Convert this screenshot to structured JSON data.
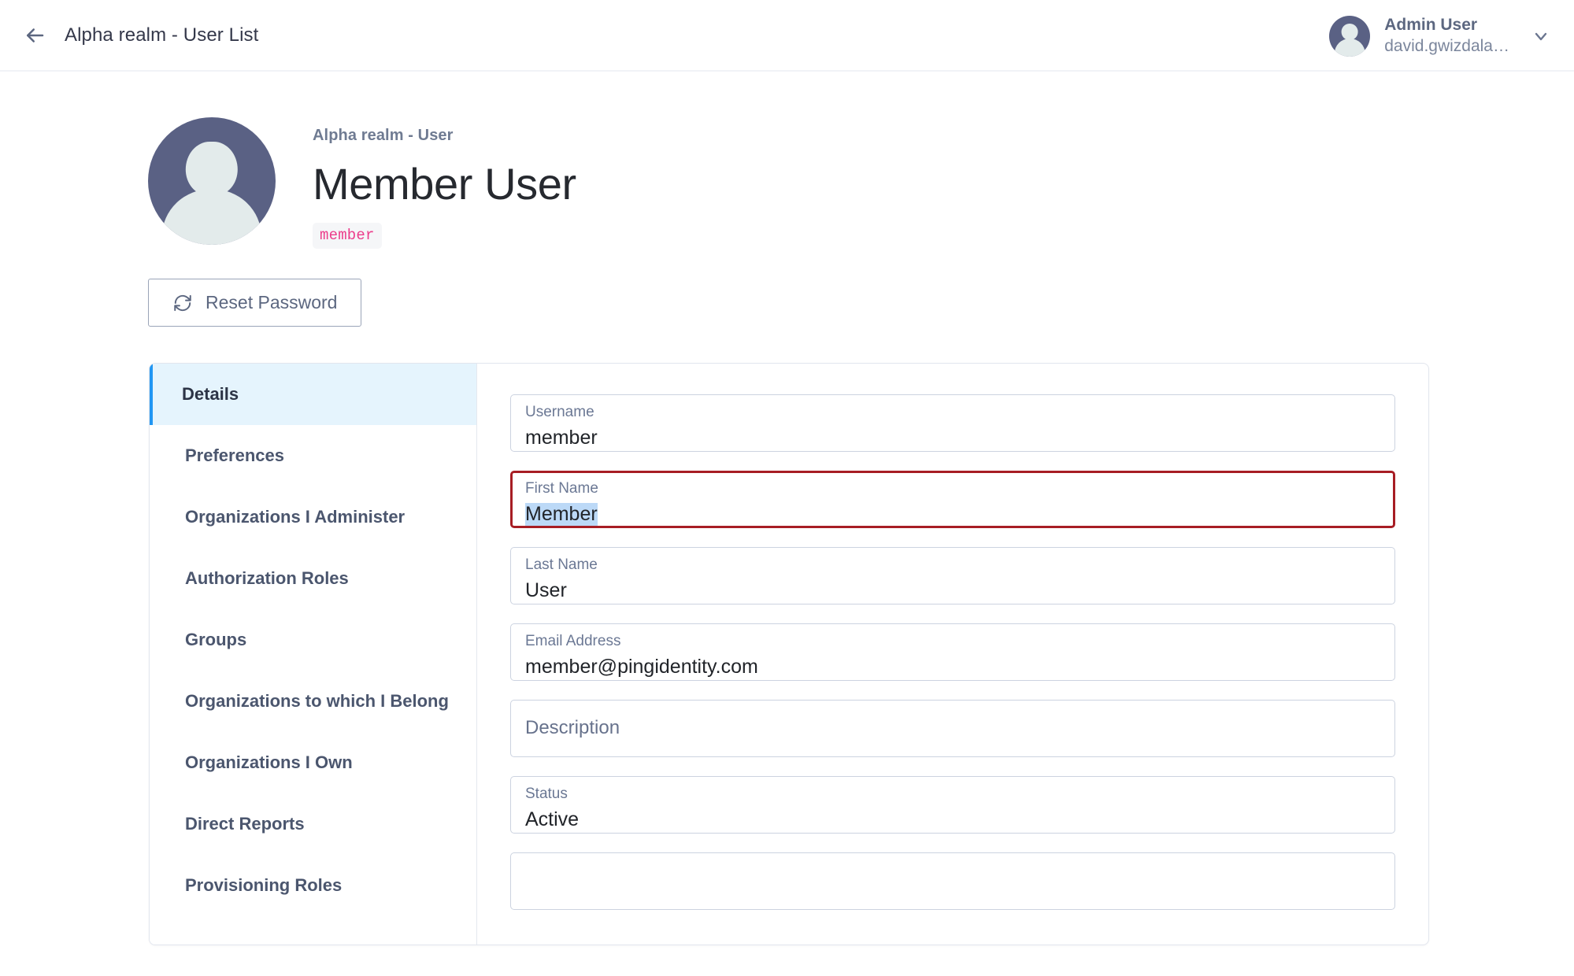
{
  "header": {
    "back_icon": "arrow-left-icon",
    "breadcrumb": "Alpha realm - User List",
    "account": {
      "name": "Admin User",
      "email": "david.gwizdala…",
      "avatar_icon": "user-avatar-icon",
      "chevron_icon": "chevron-down-icon"
    }
  },
  "profile": {
    "avatar_icon": "user-avatar-icon",
    "realm_label": "Alpha realm - User",
    "name": "Member User",
    "badge": "member"
  },
  "actions": {
    "reset_password_label": "Reset Password",
    "reset_password_icon": "refresh-icon"
  },
  "sidebar": {
    "items": [
      {
        "label": "Details",
        "active": true
      },
      {
        "label": "Preferences",
        "active": false
      },
      {
        "label": "Organizations I Administer",
        "active": false
      },
      {
        "label": "Authorization Roles",
        "active": false
      },
      {
        "label": "Groups",
        "active": false
      },
      {
        "label": "Organizations to which I Belong",
        "active": false
      },
      {
        "label": "Organizations I Own",
        "active": false
      },
      {
        "label": "Direct Reports",
        "active": false
      },
      {
        "label": "Provisioning Roles",
        "active": false
      }
    ]
  },
  "form": {
    "fields": [
      {
        "label": "Username",
        "value": "member",
        "state": "normal",
        "selected": false
      },
      {
        "label": "First Name",
        "value": "Member",
        "state": "error",
        "selected": true
      },
      {
        "label": "Last Name",
        "value": "User",
        "state": "normal",
        "selected": false
      },
      {
        "label": "Email Address",
        "value": "member@pingidentity.com",
        "state": "normal",
        "selected": false
      },
      {
        "label": "Description",
        "value": "",
        "state": "empty",
        "selected": false
      },
      {
        "label": "Status",
        "value": "Active",
        "state": "normal",
        "selected": false
      }
    ]
  },
  "colors": {
    "accent_blue": "#2196f3",
    "active_row_bg": "#e5f4fd",
    "error_border": "#a71d24",
    "badge_text": "#ec3d8b",
    "avatar_bg": "#5a6184",
    "selection_bg": "#bcd9f7"
  }
}
